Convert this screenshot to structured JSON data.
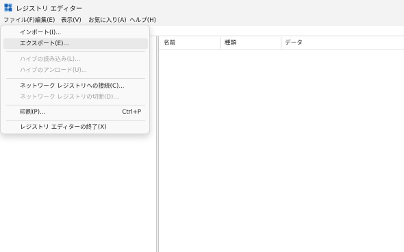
{
  "title_bar": {
    "title": "レジストリ エディター",
    "icon": "registry-editor-icon"
  },
  "menu_bar": {
    "items": [
      {
        "label": "ファイル(F)"
      },
      {
        "label": "編集(E)"
      },
      {
        "label": "表示(V)"
      },
      {
        "label": "お気に入り(A)"
      },
      {
        "label": "ヘルプ(H)"
      }
    ]
  },
  "list_pane": {
    "columns": [
      {
        "label": "名前"
      },
      {
        "label": "種類"
      },
      {
        "label": "データ"
      }
    ]
  },
  "file_menu": {
    "items": [
      {
        "label": "インポート(I)...",
        "enabled": true
      },
      {
        "label": "エクスポート(E)...",
        "enabled": true,
        "highlighted": true
      },
      {
        "label": "ハイブの読み込み(L)...",
        "enabled": false
      },
      {
        "label": "ハイブのアンロード(U)...",
        "enabled": false
      },
      {
        "label": "ネットワーク レジストリへの接続(C)...",
        "enabled": true
      },
      {
        "label": "ネットワーク レジストリの切断(D)...",
        "enabled": false
      },
      {
        "label": "印刷(P)...",
        "enabled": true,
        "shortcut": "Ctrl+P"
      },
      {
        "label": "レジストリ エディターの終了(X)",
        "enabled": true
      }
    ]
  },
  "colors": {
    "chrome_bg": "#f3f3f3",
    "menu_bg": "#f9f9f9",
    "hover_bg": "#e9e9e9",
    "disabled_text": "#a3a3a3",
    "icon_blue": "#1e6fc8"
  }
}
